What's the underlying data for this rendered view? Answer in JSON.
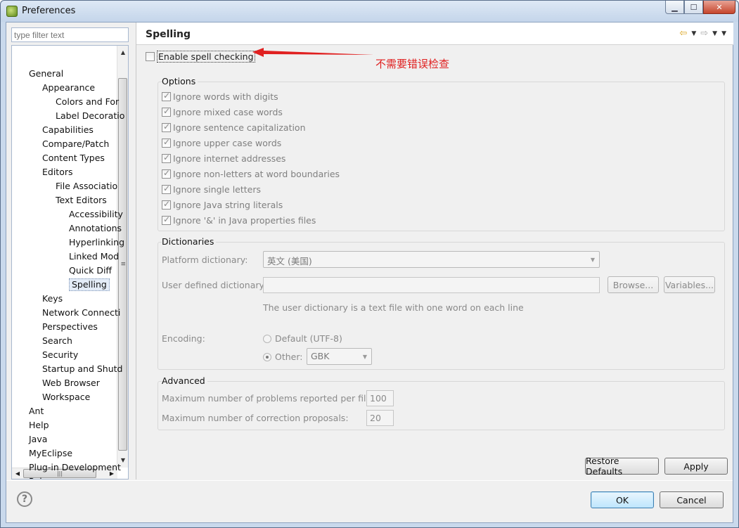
{
  "window": {
    "title": "Preferences",
    "controls": {
      "minimize": "▁",
      "maximize": "☐",
      "close": "✕"
    }
  },
  "filter": {
    "placeholder": "type filter text"
  },
  "tree": {
    "items": [
      {
        "label": "General",
        "level": 0
      },
      {
        "label": "Appearance",
        "level": 1
      },
      {
        "label": "Colors and For",
        "level": 2
      },
      {
        "label": "Label Decoratio",
        "level": 2
      },
      {
        "label": "Capabilities",
        "level": 1
      },
      {
        "label": "Compare/Patch",
        "level": 1
      },
      {
        "label": "Content Types",
        "level": 1
      },
      {
        "label": "Editors",
        "level": 1
      },
      {
        "label": "File Associatio",
        "level": 2
      },
      {
        "label": "Text Editors",
        "level": 2
      },
      {
        "label": "Accessibility",
        "level": 3
      },
      {
        "label": "Annotations",
        "level": 3
      },
      {
        "label": "Hyperlinking",
        "level": 3
      },
      {
        "label": "Linked Mod",
        "level": 3
      },
      {
        "label": "Quick Diff",
        "level": 3
      },
      {
        "label": "Spelling",
        "level": 3,
        "selected": true
      },
      {
        "label": "Keys",
        "level": 1
      },
      {
        "label": "Network Connecti",
        "level": 1
      },
      {
        "label": "Perspectives",
        "level": 1
      },
      {
        "label": "Search",
        "level": 1
      },
      {
        "label": "Security",
        "level": 1
      },
      {
        "label": "Startup and Shutd",
        "level": 1
      },
      {
        "label": "Web Browser",
        "level": 1
      },
      {
        "label": "Workspace",
        "level": 1
      },
      {
        "label": "Ant",
        "level": 0
      },
      {
        "label": "Help",
        "level": 0
      },
      {
        "label": "Java",
        "level": 0
      },
      {
        "label": "MyEclipse",
        "level": 0
      },
      {
        "label": "Plug-in Development",
        "level": 0
      },
      {
        "label": "Pulse",
        "level": 0
      }
    ]
  },
  "page": {
    "title": "Spelling",
    "enable_spell_checking": {
      "label": "Enable spell checking",
      "checked": false
    },
    "annotation": "不需要错误检查",
    "annotation_color": "#e02020",
    "options": {
      "title": "Options",
      "items": [
        "Ignore words with digits",
        "Ignore mixed case words",
        "Ignore sentence capitalization",
        "Ignore upper case words",
        "Ignore internet addresses",
        "Ignore non-letters at word boundaries",
        "Ignore single letters",
        "Ignore Java string literals",
        "Ignore '&' in Java properties files"
      ]
    },
    "dictionaries": {
      "title": "Dictionaries",
      "platform_label": "Platform dictionary:",
      "platform_value": "英文 (美国)",
      "user_label": "User defined dictionary:",
      "user_value": "",
      "browse_label": "Browse...",
      "variables_label": "Variables...",
      "hint": "The user dictionary is a text file with one word on each line",
      "encoding_label": "Encoding:",
      "default_label": "Default (UTF-8)",
      "other_label": "Other:",
      "other_value": "GBK"
    },
    "advanced": {
      "title": "Advanced",
      "max_problems_label": "Maximum number of problems reported per file:",
      "max_problems_value": "100",
      "max_proposals_label": "Maximum number of correction proposals:",
      "max_proposals_value": "20"
    },
    "restore_defaults_label": "Restore Defaults",
    "apply_label": "Apply"
  },
  "footer": {
    "help_icon": "?",
    "ok_label": "OK",
    "cancel_label": "Cancel"
  }
}
